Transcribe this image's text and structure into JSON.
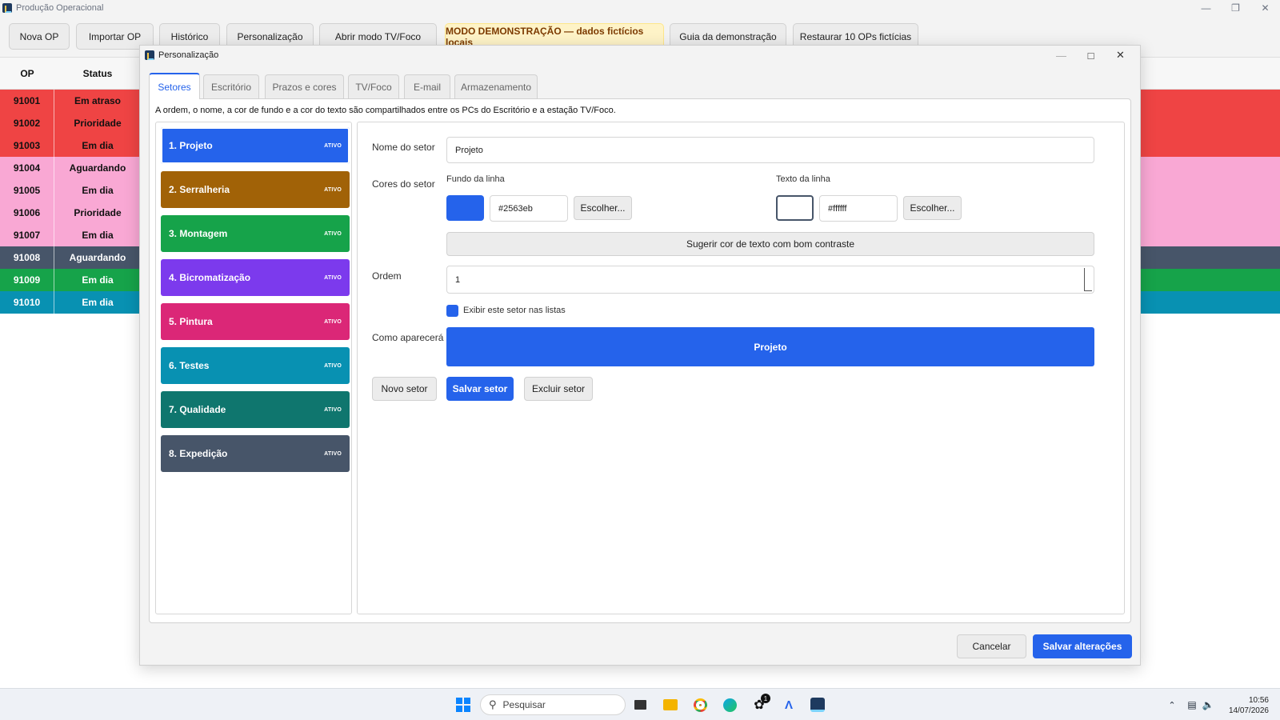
{
  "window": {
    "title": "Produção Operacional"
  },
  "toolbar": {
    "buttons": [
      "Nova OP",
      "Importar OP",
      "Histórico",
      "Personalização",
      "Abrir modo TV/Foco"
    ],
    "demo_label": "MODO DEMONSTRAÇÃO — dados fictícios locais",
    "guide_label": "Guia da demonstração",
    "restore_label": "Restaurar 10 OPs fictícias"
  },
  "table": {
    "headers": {
      "op": "OP",
      "status": "Status"
    },
    "rows": [
      {
        "op": "91001",
        "status": "Em atraso",
        "bg": "#ef4444",
        "fg": "#111111"
      },
      {
        "op": "91002",
        "status": "Prioridade",
        "bg": "#ef4444",
        "fg": "#111111"
      },
      {
        "op": "91003",
        "status": "Em dia",
        "bg": "#ef4444",
        "fg": "#111111"
      },
      {
        "op": "91004",
        "status": "Aguardando",
        "bg": "#f9a8d4",
        "fg": "#111111"
      },
      {
        "op": "91005",
        "status": "Em dia",
        "bg": "#f9a8d4",
        "fg": "#111111"
      },
      {
        "op": "91006",
        "status": "Prioridade",
        "bg": "#f9a8d4",
        "fg": "#111111"
      },
      {
        "op": "91007",
        "status": "Em dia",
        "bg": "#f9a8d4",
        "fg": "#111111"
      },
      {
        "op": "91008",
        "status": "Aguardando",
        "bg": "#475569",
        "fg": "#ffffff"
      },
      {
        "op": "91009",
        "status": "Em dia",
        "bg": "#16a34a",
        "fg": "#ffffff"
      },
      {
        "op": "91010",
        "status": "Em dia",
        "bg": "#0891b2",
        "fg": "#ffffff"
      }
    ]
  },
  "dialog": {
    "title": "Personalização",
    "tabs": [
      "Setores",
      "Escritório",
      "Prazos e cores",
      "TV/Foco",
      "E-mail",
      "Armazenamento"
    ],
    "active_tab": 0,
    "intro": "A ordem, o nome, a cor de fundo e a cor do texto são compartilhados entre os PCs do Escritório e a estação TV/Foco.",
    "sectors": [
      {
        "label": "1. Projeto",
        "badge": "ATIVO",
        "bg": "#2563eb",
        "fg": "#ffffff"
      },
      {
        "label": "2. Serralheria",
        "badge": "ATIVO",
        "bg": "#a16207",
        "fg": "#ffffff"
      },
      {
        "label": "3. Montagem",
        "badge": "ATIVO",
        "bg": "#16a34a",
        "fg": "#ffffff"
      },
      {
        "label": "4. Bicromatização",
        "badge": "ATIVO",
        "bg": "#7c3aed",
        "fg": "#ffffff"
      },
      {
        "label": "5. Pintura",
        "badge": "ATIVO",
        "bg": "#db2777",
        "fg": "#ffffff"
      },
      {
        "label": "6. Testes",
        "badge": "ATIVO",
        "bg": "#0891b2",
        "fg": "#ffffff"
      },
      {
        "label": "7. Qualidade",
        "badge": "ATIVO",
        "bg": "#0f766e",
        "fg": "#ffffff"
      },
      {
        "label": "8. Expedição",
        "badge": "ATIVO",
        "bg": "#475569",
        "fg": "#ffffff"
      }
    ],
    "form": {
      "name_label": "Nome do setor",
      "name_value": "Projeto",
      "colors_label": "Cores do setor",
      "bg_label": "Fundo da linha",
      "bg_value": "#2563eb",
      "text_label": "Texto da linha",
      "text_value": "#ffffff",
      "choose_label": "Escolher...",
      "suggest_label": "Sugerir cor de texto com bom contraste",
      "order_label": "Ordem",
      "order_value": "1",
      "show_label": "Exibir este setor nas listas",
      "preview_label": "Como aparecerá",
      "preview_text": "Projeto",
      "new_label": "Novo setor",
      "save_label": "Salvar setor",
      "delete_label": "Excluir setor"
    },
    "cancel_label": "Cancelar",
    "save_all_label": "Salvar alterações"
  },
  "taskbar": {
    "search_placeholder": "Pesquisar",
    "badge_count": "1",
    "time": "10:56",
    "date": "14/07/2026"
  }
}
